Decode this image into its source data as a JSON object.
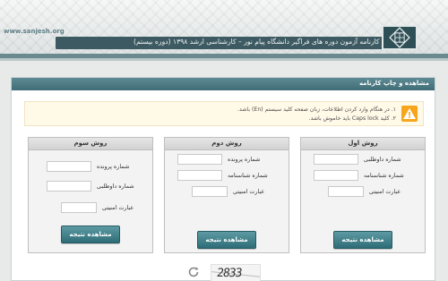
{
  "header": {
    "site_url": "www.sanjesh.org",
    "title": "اعلام نتایج کارنامه آزمون دوره های فراگیر دانشگاه پیام نور – کارشناسی ارشد ۱۳۹۸ (دوره بیستم)",
    "colors": {
      "title_bar": "#3d5a62",
      "stripe": "#6b8a90"
    }
  },
  "panel": {
    "title": "مشاهده و چاپ کارنامه"
  },
  "notice": {
    "icon": "warning-icon",
    "line1": "۱. در هنگام وارد کردن اطلاعات، زبان صفحه کلید سیستم (En) باشد.",
    "line2": "۲. کلید Caps lock باید خاموش باشد."
  },
  "boxes": [
    {
      "title": "روش اول",
      "fields": [
        {
          "label": "شماره داوطلبی"
        },
        {
          "label": "شماره شناسنامه"
        },
        {
          "label": "عبارت امنیتی"
        }
      ],
      "button": "مشاهده نتیجه"
    },
    {
      "title": "روش دوم",
      "fields": [
        {
          "label": "شماره پرونده"
        },
        {
          "label": "شماره شناسنامه"
        },
        {
          "label": "عبارت امنیتی"
        }
      ],
      "button": "مشاهده نتیجه"
    },
    {
      "title": "روش سوم",
      "fields": [
        {
          "label": "شماره پرونده"
        },
        {
          "label": "شماره داوطلبی"
        },
        {
          "label": "عبارت امنیتی"
        }
      ],
      "button": "مشاهده نتیجه"
    }
  ],
  "captcha": {
    "text": "2833",
    "refresh_icon": "refresh-icon"
  }
}
